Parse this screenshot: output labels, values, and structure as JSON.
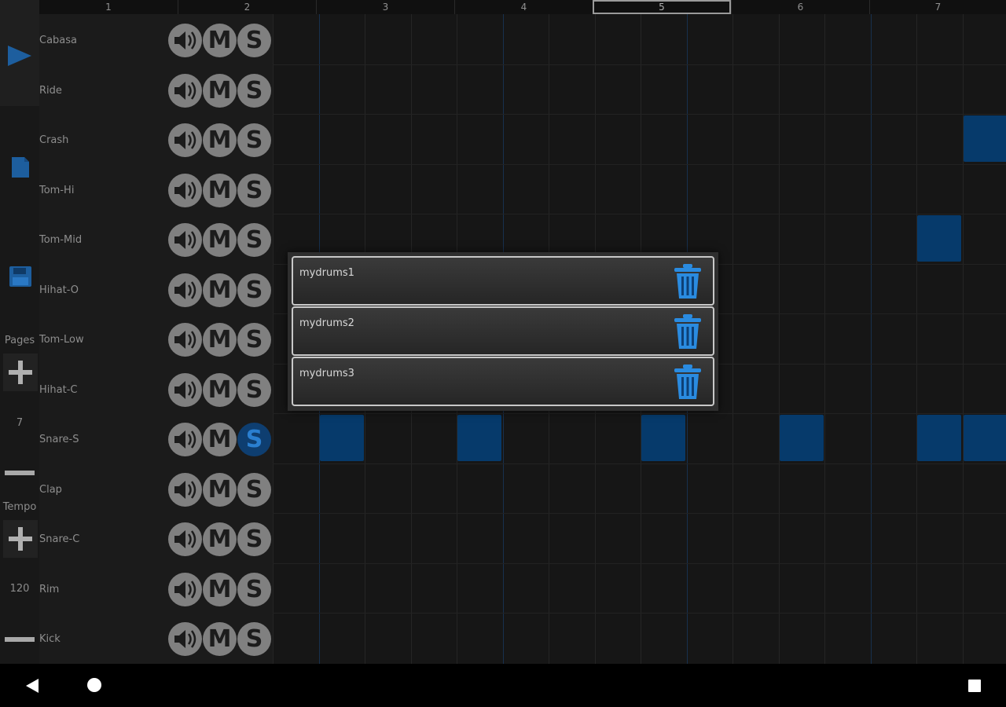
{
  "ruler": {
    "bars": [
      "1",
      "2",
      "3",
      "4",
      "5",
      "6",
      "7"
    ],
    "active_bar": "5"
  },
  "sidebar": {
    "pages_label": "Pages",
    "pages_value": "7",
    "tempo_label": "Tempo",
    "tempo_value": "120",
    "icons": [
      "play-icon",
      "new-file-icon",
      "save-icon",
      "plus-icon",
      "minus-icon"
    ]
  },
  "tracks": [
    {
      "name": "Cabasa"
    },
    {
      "name": "Ride"
    },
    {
      "name": "Crash"
    },
    {
      "name": "Tom-Hi"
    },
    {
      "name": "Tom-Mid"
    },
    {
      "name": "Hihat-O"
    },
    {
      "name": "Tom-Low"
    },
    {
      "name": "Hihat-C"
    },
    {
      "name": "Snare-S"
    },
    {
      "name": "Clap"
    },
    {
      "name": "Snare-C"
    },
    {
      "name": "Rim"
    },
    {
      "name": "Kick"
    }
  ],
  "track_buttons": {
    "mute": "M",
    "solo": "S"
  },
  "solo_active_track": "Snare-S",
  "dialog": {
    "files": [
      {
        "name": "mydrums1"
      },
      {
        "name": "mydrums2"
      },
      {
        "name": "mydrums3"
      }
    ]
  },
  "colors": {
    "accent": "#2a8be0",
    "cell_on": "#063a6b",
    "bg": "#1b1b1b"
  }
}
